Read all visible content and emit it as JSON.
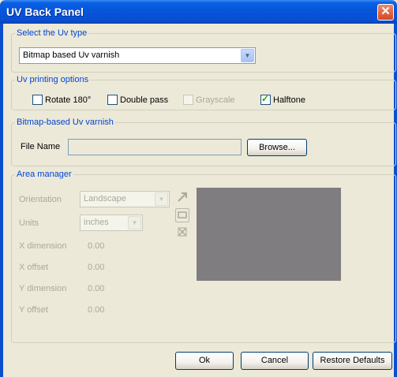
{
  "window": {
    "title": "UV Back Panel",
    "close_glyph": "✕"
  },
  "uv_type": {
    "legend": "Select the Uv type",
    "selected": "Bitmap based Uv varnish"
  },
  "printing_options": {
    "legend": "Uv printing options",
    "items": [
      {
        "label": "Rotate 180°",
        "checked": false,
        "enabled": true
      },
      {
        "label": "Double pass",
        "checked": false,
        "enabled": true
      },
      {
        "label": "Grayscale",
        "checked": false,
        "enabled": false
      },
      {
        "label": "Halftone",
        "checked": true,
        "enabled": true
      }
    ]
  },
  "bitmap_varnish": {
    "legend": "Bitmap-based Uv varnish",
    "file_name_label": "File Name",
    "file_name_value": "",
    "browse_label": "Browse..."
  },
  "area_manager": {
    "legend": "Area manager",
    "orientation_label": "Orientation",
    "orientation_value": "Landscape",
    "units_label": "Units",
    "units_value": "inches",
    "x_dimension_label": "X dimension",
    "x_dimension_value": "0.00",
    "x_offset_label": "X offset",
    "x_offset_value": "0.00",
    "y_dimension_label": "Y dimension",
    "y_dimension_value": "0.00",
    "y_offset_label": "Y offset",
    "y_offset_value": "0.00",
    "tools": [
      "arrow-tool-icon",
      "rectangle-tool-icon",
      "delete-tool-icon"
    ],
    "preview_color": "#7f7d80"
  },
  "buttons": {
    "ok": "Ok",
    "cancel": "Cancel",
    "restore_defaults": "Restore Defaults"
  }
}
